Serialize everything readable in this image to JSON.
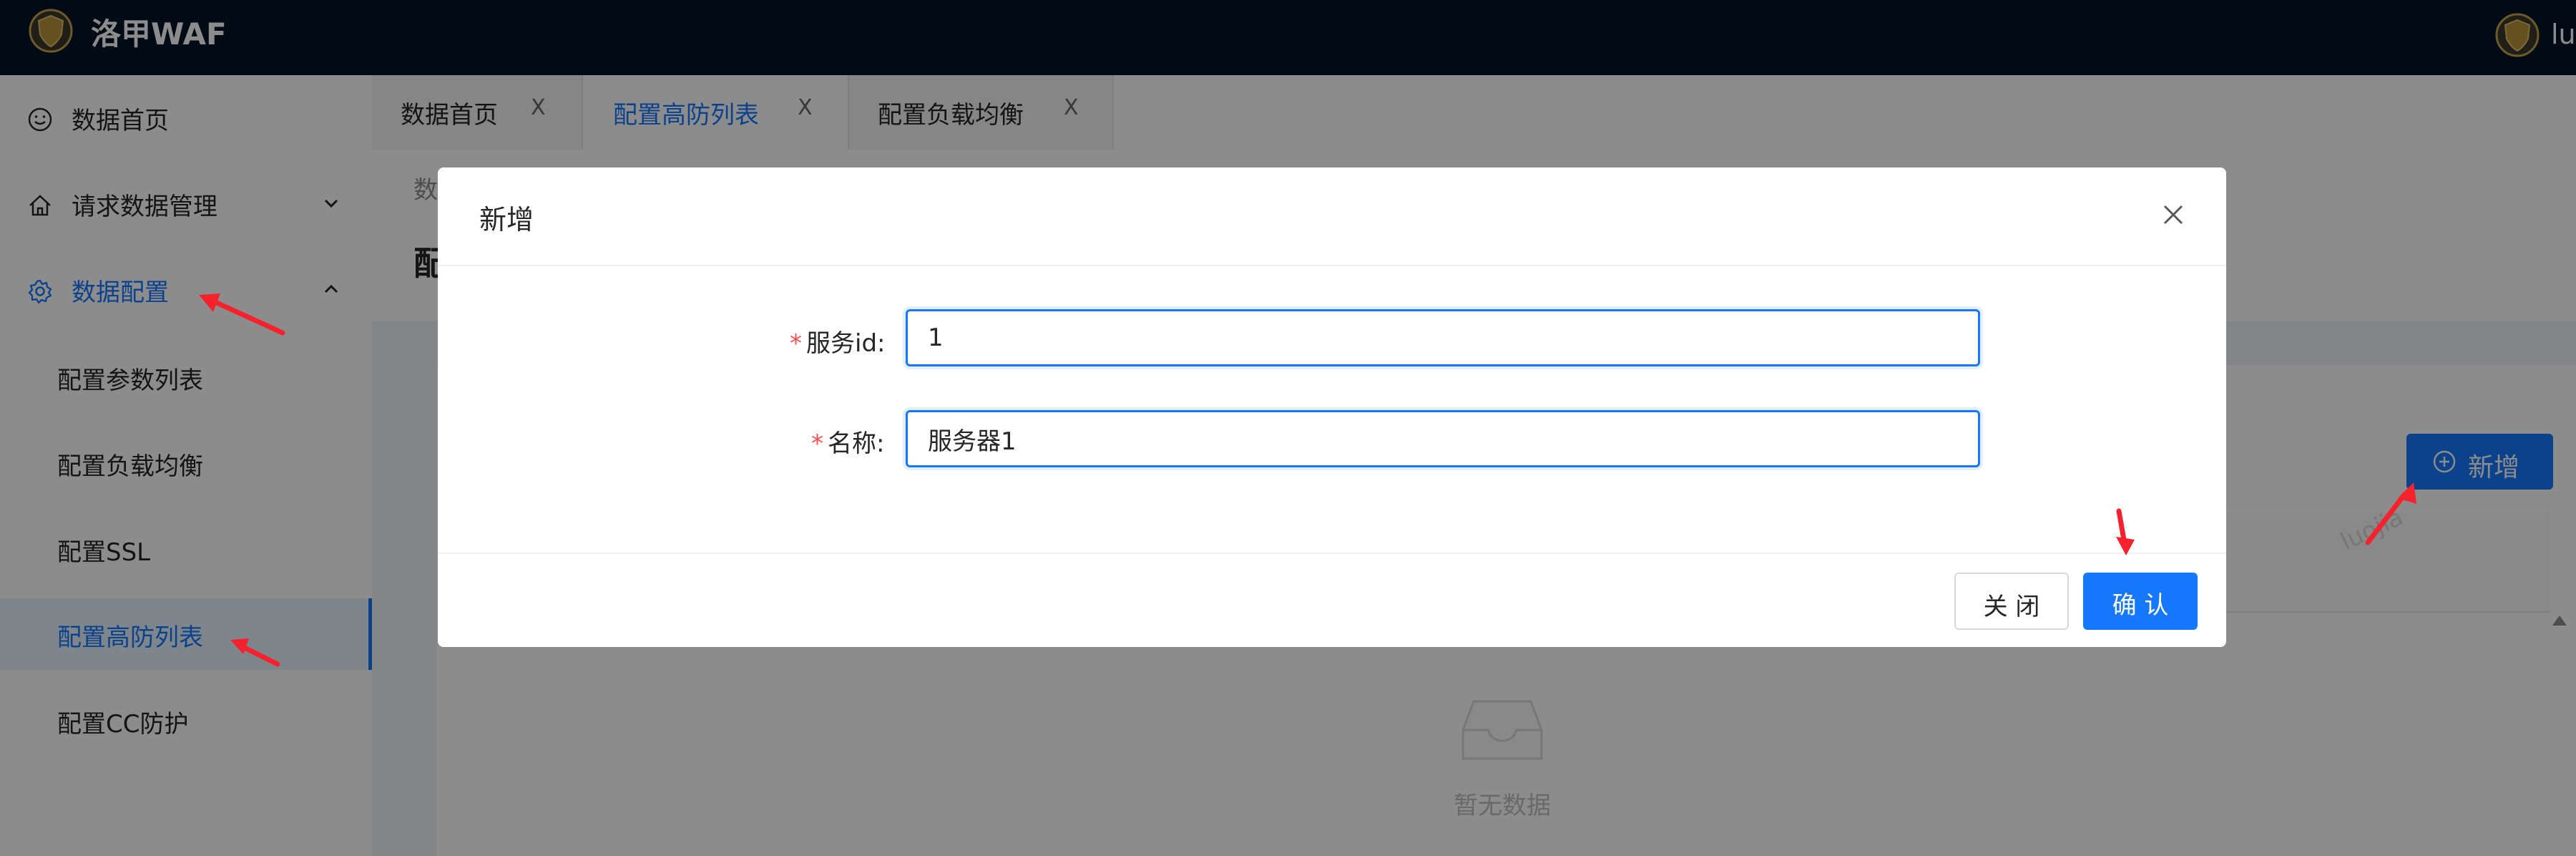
{
  "app": {
    "title": "洛甲WAF",
    "user": "lu"
  },
  "sidebar": {
    "items": [
      {
        "label": "数据首页",
        "icon": "smile-icon"
      },
      {
        "label": "请求数据管理",
        "icon": "home-icon"
      },
      {
        "label": "数据配置",
        "icon": "gear-icon"
      }
    ],
    "sub_items": [
      {
        "label": "配置参数列表"
      },
      {
        "label": "配置负载均衡"
      },
      {
        "label": "配置SSL"
      },
      {
        "label": "配置高防列表"
      },
      {
        "label": "配置CC防护"
      }
    ]
  },
  "tabs": [
    {
      "label": "数据首页",
      "close": "X"
    },
    {
      "label": "配置高防列表",
      "close": "X"
    },
    {
      "label": "配置负载均衡",
      "close": "X"
    }
  ],
  "content": {
    "breadcrumb": "数",
    "title": "配",
    "add_button": "新增",
    "empty_text": "暂无数据",
    "watermark": "luojia"
  },
  "modal": {
    "title": "新增",
    "fields": [
      {
        "label": "服务id:",
        "value": "1",
        "required": true
      },
      {
        "label": "名称:",
        "value": "服务器1",
        "required": true
      }
    ],
    "close_button": "关 闭",
    "confirm_button": "确 认"
  },
  "colors": {
    "header_bg": "#001529",
    "primary": "#1677ff",
    "required": "#ff4d4f",
    "annotation_arrow": "#f5222d"
  }
}
